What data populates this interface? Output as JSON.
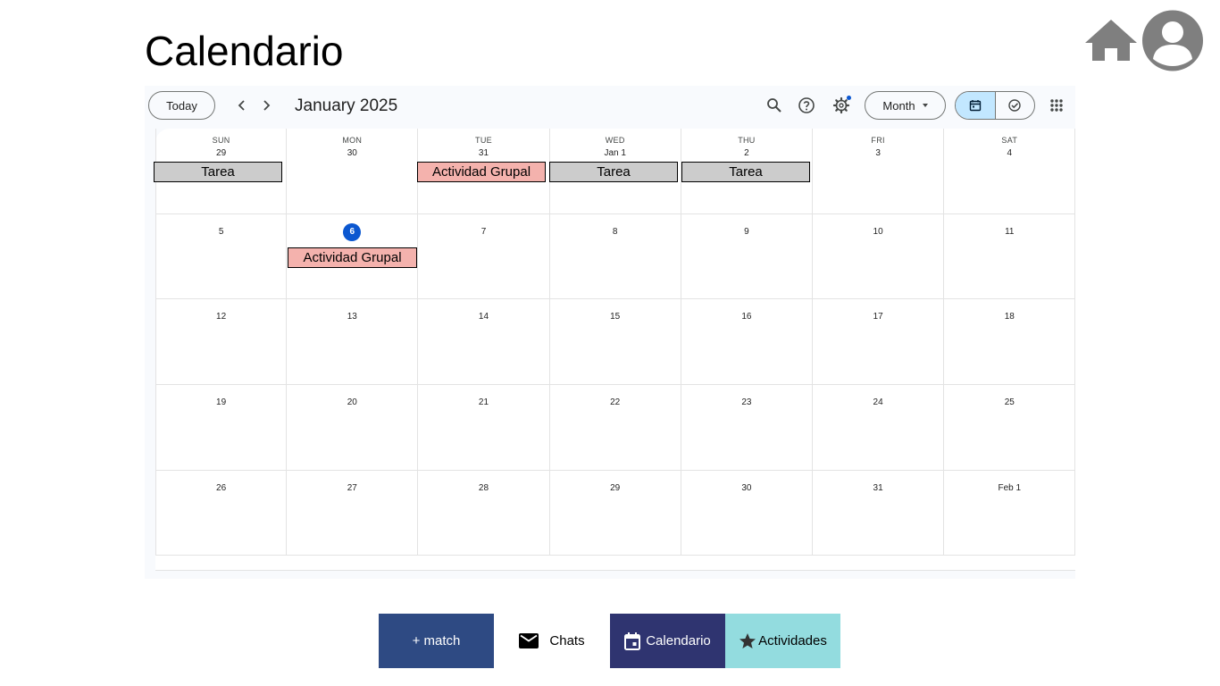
{
  "page": {
    "title": "Calendario"
  },
  "header_icons": {
    "home": "home-icon",
    "profile": "user-avatar-icon"
  },
  "toolbar": {
    "today_label": "Today",
    "month_label": "January 2025",
    "view_label": "Month"
  },
  "calendar": {
    "weekdays": [
      "SUN",
      "MON",
      "TUE",
      "WED",
      "THU",
      "FRI",
      "SAT"
    ],
    "weeks": [
      [
        "29",
        "30",
        "31",
        "Jan 1",
        "2",
        "3",
        "4"
      ],
      [
        "5",
        "6",
        "7",
        "8",
        "9",
        "10",
        "11"
      ],
      [
        "12",
        "13",
        "14",
        "15",
        "16",
        "17",
        "18"
      ],
      [
        "19",
        "20",
        "21",
        "22",
        "23",
        "24",
        "25"
      ],
      [
        "26",
        "27",
        "28",
        "29",
        "30",
        "31",
        "Feb 1"
      ]
    ],
    "today_label": "6",
    "events": [
      {
        "label": "Tarea",
        "type": "tarea",
        "day": "29"
      },
      {
        "label": "Actividad Grupal",
        "type": "grupal",
        "day": "31"
      },
      {
        "label": "Tarea",
        "type": "tarea",
        "day": "Jan 1"
      },
      {
        "label": "Tarea",
        "type": "tarea",
        "day": "2"
      },
      {
        "label": "Actividad Grupal",
        "type": "grupal",
        "day": "6"
      }
    ]
  },
  "bottom_nav": {
    "match_label": "+ match",
    "chats_label": "Chats",
    "calendario_label": "Calendario",
    "actividades_label": "Actividades"
  },
  "colors": {
    "tarea": "#cccccc",
    "actividad_grupal": "#f4b2ad",
    "today_accent": "#0b57d0",
    "nav_match": "#2e4a83",
    "nav_calendario": "#2f3470",
    "nav_actividades": "#93dcdf"
  }
}
